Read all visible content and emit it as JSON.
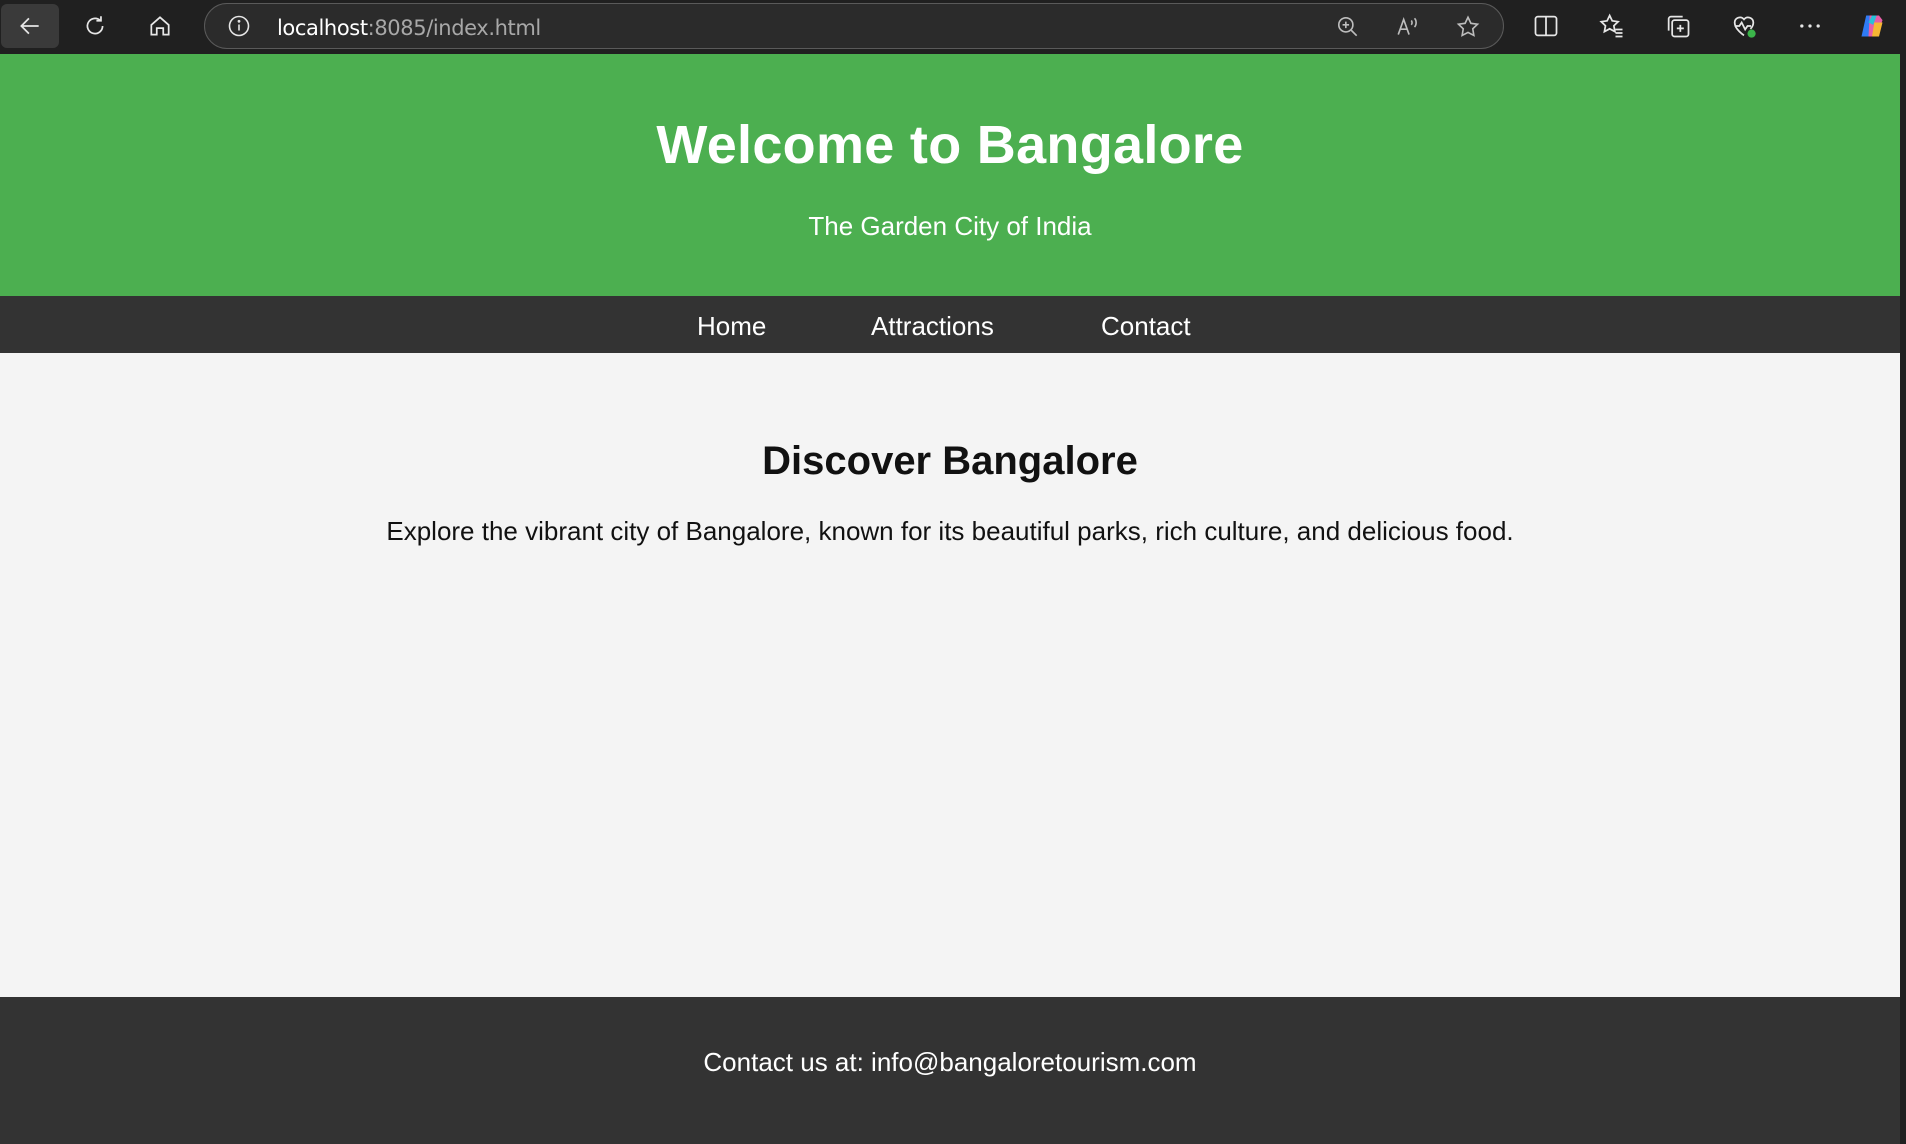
{
  "browser": {
    "address_host": "localhost",
    "address_path": ":8085/index.html",
    "icons": [
      "back-arrow-icon",
      "reload-icon",
      "home-icon",
      "info-icon",
      "zoom-icon",
      "read-aloud-icon",
      "favorite-star-icon",
      "split-screen-icon",
      "favorites-icon",
      "collections-icon",
      "browser-essentials-icon",
      "more-options-icon",
      "copilot-icon"
    ]
  },
  "header": {
    "title": "Welcome to Bangalore",
    "subtitle": "The Garden City of India"
  },
  "nav": {
    "items": [
      {
        "label": "Home"
      },
      {
        "label": "Attractions"
      },
      {
        "label": "Contact"
      }
    ]
  },
  "main": {
    "title": "Discover Bangalore",
    "text": "Explore the vibrant city of Bangalore, known for its beautiful parks, rich culture, and delicious food."
  },
  "footer": {
    "text": "Contact us at: info@bangaloretourism.com"
  },
  "colors": {
    "header_bg": "#4caf50",
    "nav_bg": "#333333",
    "page_bg": "#f4f4f4",
    "footer_bg": "#333333"
  }
}
